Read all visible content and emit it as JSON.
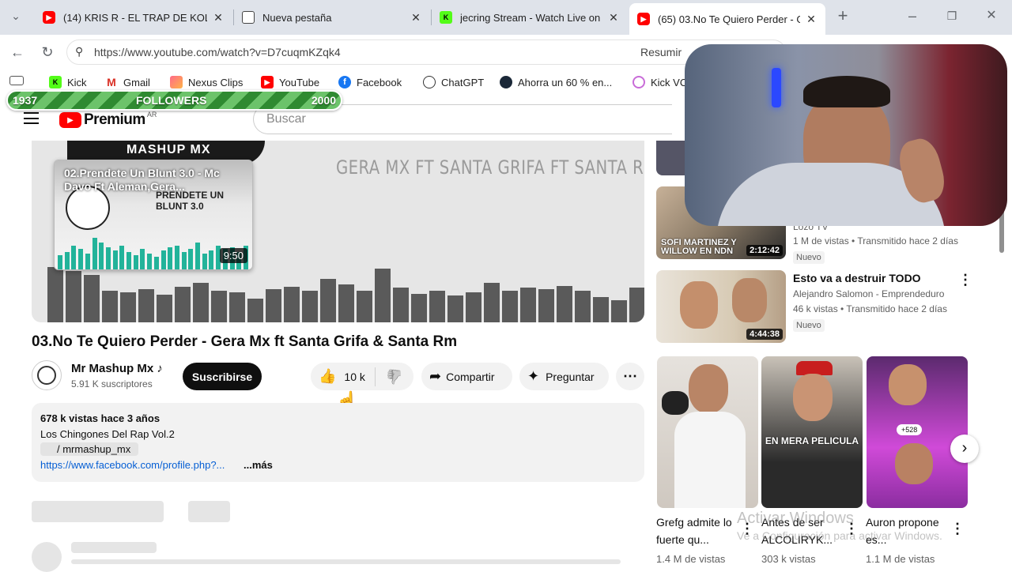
{
  "browser": {
    "tabs": [
      {
        "title": "(14) KRIS R - EL TRAP DE KOLOM",
        "icon": "youtube-icon",
        "active": false
      },
      {
        "title": "Nueva pestaña",
        "icon": "newtab-icon",
        "active": false
      },
      {
        "title": "jecring Stream - Watch Live on K",
        "icon": "kick-icon",
        "active": false
      },
      {
        "title": "(65) 03.No Te Quiero Perder - Ge",
        "icon": "youtube-icon",
        "active": true
      }
    ],
    "url": "https://www.youtube.com/watch?v=D7cuqmKZqk4",
    "summary_label": "Resumir",
    "bookmarks": [
      {
        "label": "Kick",
        "icon": "kick-icon"
      },
      {
        "label": "Gmail",
        "icon": "gmail-icon"
      },
      {
        "label": "Nexus Clips",
        "icon": "nexus-icon"
      },
      {
        "label": "YouTube",
        "icon": "youtube-icon"
      },
      {
        "label": "Facebook",
        "icon": "facebook-icon"
      },
      {
        "label": "ChatGPT",
        "icon": "chatgpt-icon"
      },
      {
        "label": "Ahorra un 60 % en...",
        "icon": "steam-icon"
      },
      {
        "label": "Kick VO",
        "icon": "kickvo-icon"
      }
    ]
  },
  "followers_goal": {
    "current": "1937",
    "label": "FOLLOWERS",
    "target": "2000",
    "progress": 0.0
  },
  "youtube": {
    "logo_text": "Premium",
    "region": "AR",
    "search_placeholder": "Buscar",
    "player": {
      "headline": "GERA MX FT SANTA GRIFA FT SANTA RM",
      "cover_text": "MASHUP MX",
      "preview_title": "02.Prendete Un Blunt 3.0 - Mc Davo Ft Aleman,Gera...",
      "preview_cover_text": "PRENDETE UN BLUNT 3.0",
      "preview_duration": "9:50"
    },
    "video": {
      "title": "03.No Te Quiero Perder - Gera Mx ft Santa Grifa & Santa Rm",
      "channel": "Mr Mashup Mx ♪",
      "subscribers": "5.91 K suscriptores",
      "subscribe_label": "Suscribirse",
      "likes": "10 k",
      "share_label": "Compartir",
      "ask_label": "Preguntar"
    },
    "description": {
      "stats": "678 k vistas  hace 3 años",
      "line1": "Los Chingones Del Rap Vol.2",
      "line2": "/ mrmashup_mx",
      "link": "https://www.facebook.com/profile.php?...",
      "more": "...más"
    },
    "related": [
      {
        "title": "",
        "channel": "Lozo TV",
        "meta": "1 M de vistas • Transmitido hace 2 días",
        "badge": "Nuevo",
        "duration": "2:12:42",
        "thumb_text": "SOFI MARTINEZ Y WILLOW EN NDN"
      },
      {
        "title": "Esto va a destruir TODO",
        "channel": "Alejandro Salomon - Emprendeduro",
        "meta": "46 k vistas • Transmitido hace 2 días",
        "badge": "Nuevo",
        "duration": "4:44:38",
        "thumb_text": ""
      }
    ],
    "shorts": [
      {
        "title": "Grefg admite lo fuerte qu...",
        "views": "1.4 M de vistas",
        "thumb_text": ""
      },
      {
        "title": "Antes de ser ALCOLIRYK...",
        "views": "303 k vistas",
        "thumb_text": "EN MERA PELICULA"
      },
      {
        "title": "Auron propone es...",
        "views": "1.1 M de vistas",
        "thumb_text": "+528"
      }
    ]
  },
  "watermark": {
    "line1": "Activar Windows",
    "line2": "Ve a Configuración para activar Windows."
  }
}
